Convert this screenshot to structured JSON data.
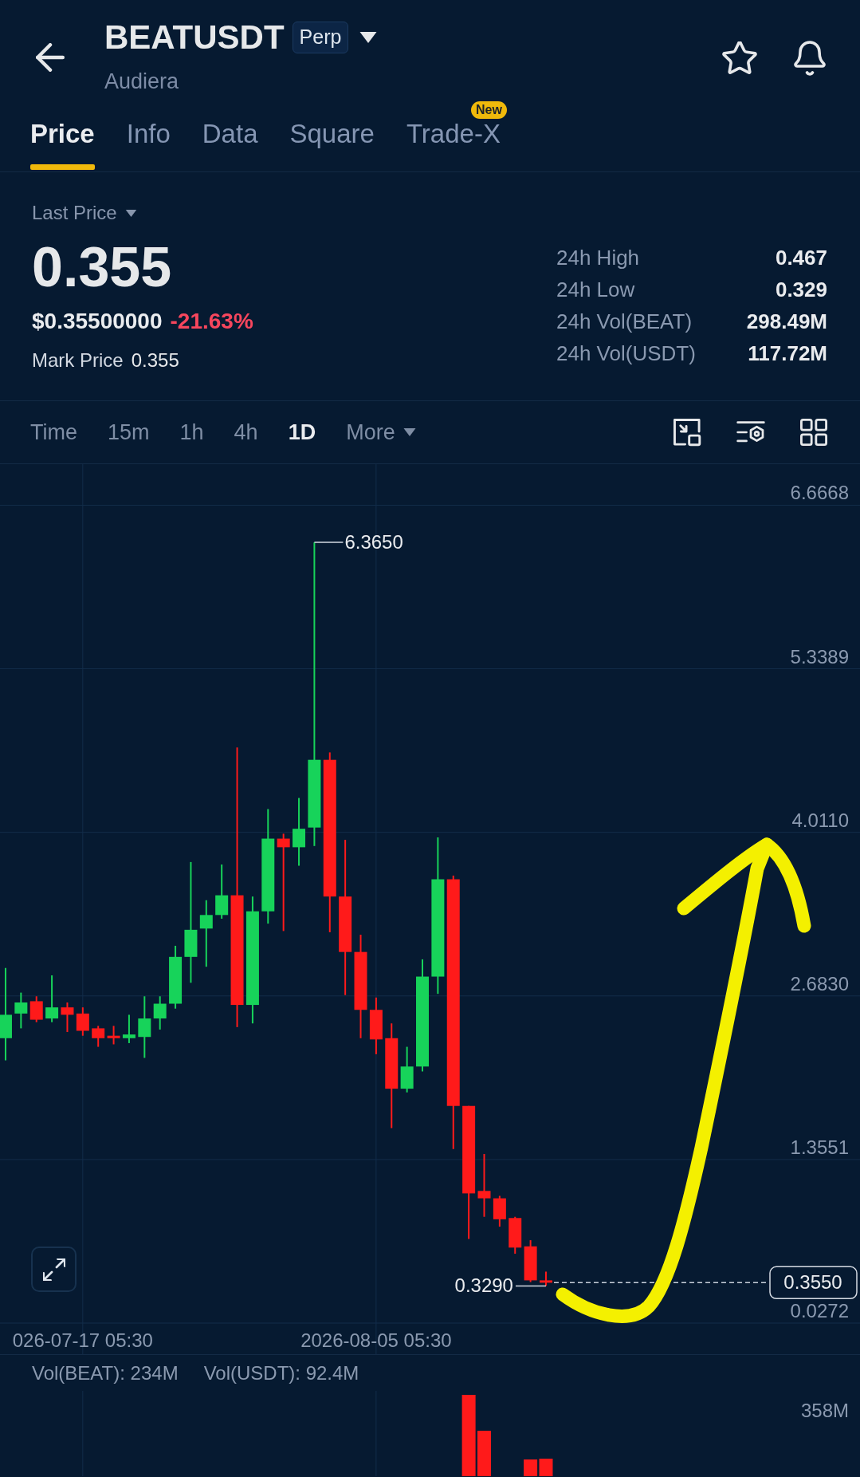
{
  "header": {
    "title": "BEATUSDT",
    "badge": "Perp",
    "subtitle": "Audiera"
  },
  "tabs": [
    {
      "label": "Price",
      "selected": true
    },
    {
      "label": "Info",
      "selected": false
    },
    {
      "label": "Data",
      "selected": false
    },
    {
      "label": "Square",
      "selected": false
    },
    {
      "label": "Trade-X",
      "selected": false,
      "badge": "New"
    }
  ],
  "ticker": {
    "price_label": "Last Price",
    "last_price": "0.355",
    "usd_price": "$0.35500000",
    "change": "-21.63%",
    "negative": true,
    "mark_price_label": "Mark Price",
    "mark_price": "0.355",
    "stats": [
      {
        "label": "24h High",
        "value": "0.467"
      },
      {
        "label": "24h Low",
        "value": "0.329"
      },
      {
        "label": "24h Vol(BEAT)",
        "value": "298.49M"
      },
      {
        "label": "24h Vol(USDT)",
        "value": "117.72M"
      }
    ]
  },
  "intervals": [
    {
      "label": "Time",
      "kind": "option",
      "selected": false
    },
    {
      "label": "15m",
      "kind": "option",
      "selected": false
    },
    {
      "label": "1h",
      "kind": "option",
      "selected": false
    },
    {
      "label": "4h",
      "kind": "option",
      "selected": false
    },
    {
      "label": "1D",
      "kind": "option",
      "selected": true
    },
    {
      "label": "More",
      "kind": "menu",
      "selected": false
    }
  ],
  "chart": {
    "y_axis_labels": [
      "6.6668",
      "5.3389",
      "4.0110",
      "2.6830",
      "1.3551",
      "0.0272"
    ],
    "x_axis_labels": [
      "026-07-17 05:30",
      "2026-08-05 05:30"
    ],
    "high_label": "6.3650",
    "low_label": "0.3290",
    "last_price_tag": "0.3550"
  },
  "volume": {
    "labels": [
      "Vol(BEAT): 234M",
      "Vol(USDT): 92.4M"
    ],
    "axis_label": "358M"
  }
}
